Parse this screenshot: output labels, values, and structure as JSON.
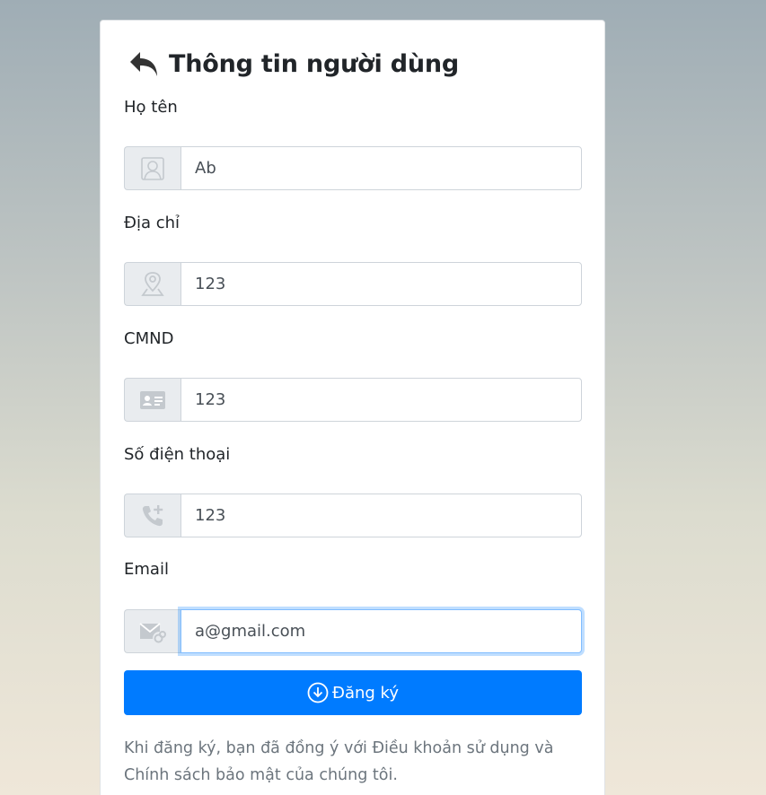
{
  "form": {
    "title": "Thông tin người dùng",
    "fields": [
      {
        "label": "Họ tên",
        "value": "Ab",
        "icon": "user-icon"
      },
      {
        "label": "Địa chỉ",
        "value": "123",
        "icon": "location-pin-icon"
      },
      {
        "label": "CMND",
        "value": "123",
        "icon": "id-card-icon"
      },
      {
        "label": "Số điện thoại",
        "value": "123",
        "icon": "phone-plus-icon"
      },
      {
        "label": "Email",
        "value": "a@gmail.com",
        "icon": "mail-link-icon"
      }
    ],
    "submit_label": "Đăng ký",
    "terms": "Khi đăng ký, bạn đã đồng ý với Điều khoản sử dụng và Chính sách bảo mật của chúng tôi."
  },
  "colors": {
    "primary": "#007bff",
    "addon_bg": "#e9ecef",
    "focus_border": "#80bdff"
  }
}
